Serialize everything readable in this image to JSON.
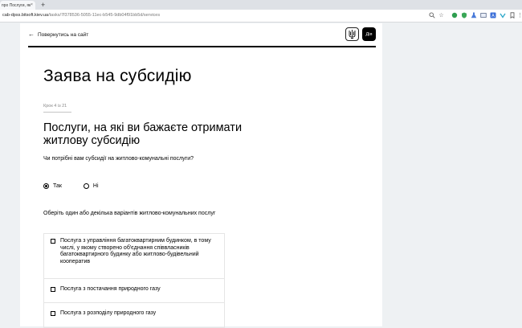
{
  "browser": {
    "tab_title": "про Послуги, як",
    "tab_close": "×",
    "new_tab": "+",
    "url_host": "cab-dpss.bitsoft.kiev.ua",
    "url_path": "/tasks/7f378536-5055-11ec-b545-9db04f91bb5d/services",
    "extensions": [
      "star-icon",
      "puzzle-icon",
      "shield-icon",
      "flask-icon",
      "mail-icon",
      "translate-icon",
      "vpn-icon",
      "bookmark-icon",
      "menu-icon"
    ]
  },
  "header": {
    "back_label": "Повернутись на сайт",
    "diia_logo": "Дія"
  },
  "form": {
    "title": "Заява на субсидію",
    "step": "Крок 4 із 21",
    "subtitle": "Послуги, на які ви бажаєте отримати житлову субсидію",
    "question": "Чи потрібні вам субсидії на житлово-комунальні послуги?",
    "radio_yes": "Так",
    "radio_no": "Ні",
    "radio_selected": "yes",
    "choose_label": "Оберіть один або декілька варіантів житлово-комунальних послуг",
    "options": [
      "Послуга з управління багатоквартирним будинком, в тому числі, у якому створено об'єднання співвласників багатоквартирного будинку або житлово-будівельний кооператив",
      "Послуга з постачання природного газу",
      "Послуга з розподілу природного газу"
    ]
  }
}
